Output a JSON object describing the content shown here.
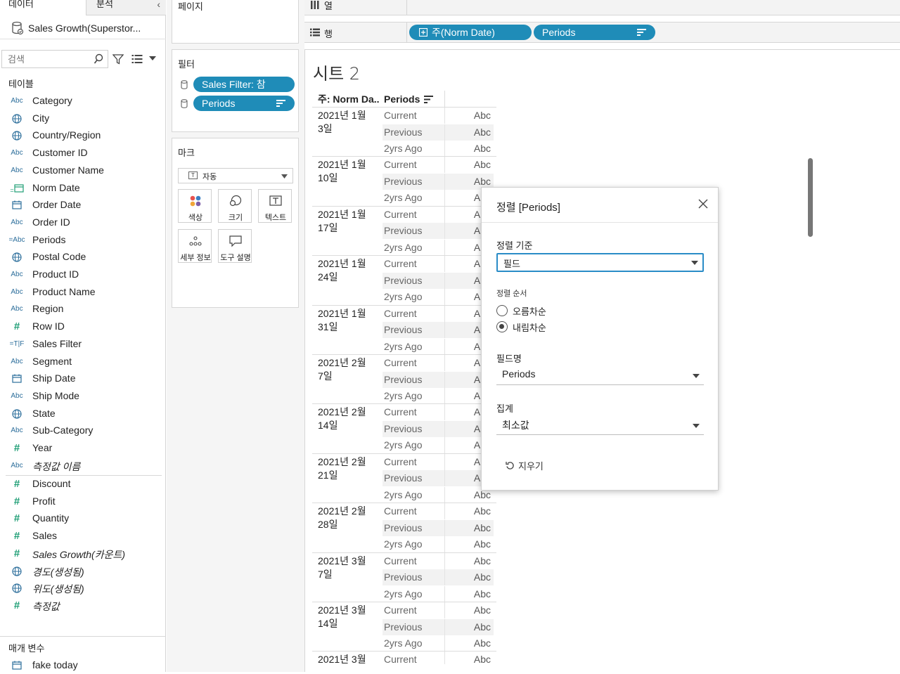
{
  "left_pane": {
    "tabs": {
      "data": "데이터",
      "analysis": "분석"
    },
    "datasource": "Sales Growth(Superstor...",
    "search_placeholder": "검색",
    "tables_title": "테이블",
    "fields": [
      {
        "icon": "Abc",
        "label": "Category"
      },
      {
        "icon": "globe",
        "label": "City"
      },
      {
        "icon": "globe",
        "label": "Country/Region"
      },
      {
        "icon": "Abc",
        "label": "Customer ID"
      },
      {
        "icon": "Abc",
        "label": "Customer Name"
      },
      {
        "icon": "calc-calendar",
        "label": "Norm Date"
      },
      {
        "icon": "calendar",
        "label": "Order Date"
      },
      {
        "icon": "Abc",
        "label": "Order ID"
      },
      {
        "icon": "=Abc",
        "label": "Periods"
      },
      {
        "icon": "globe",
        "label": "Postal Code"
      },
      {
        "icon": "Abc",
        "label": "Product ID"
      },
      {
        "icon": "Abc",
        "label": "Product Name"
      },
      {
        "icon": "Abc",
        "label": "Region"
      },
      {
        "icon": "#",
        "label": "Row ID"
      },
      {
        "icon": "=T|F",
        "label": "Sales Filter"
      },
      {
        "icon": "Abc",
        "label": "Segment"
      },
      {
        "icon": "calendar",
        "label": "Ship Date"
      },
      {
        "icon": "Abc",
        "label": "Ship Mode"
      },
      {
        "icon": "globe",
        "label": "State"
      },
      {
        "icon": "Abc",
        "label": "Sub-Category"
      },
      {
        "icon": "#",
        "label": "Year"
      },
      {
        "icon": "Abc",
        "label": "측정값 이름",
        "italic": true
      }
    ],
    "measures": [
      {
        "icon": "#",
        "label": "Discount"
      },
      {
        "icon": "#",
        "label": "Profit"
      },
      {
        "icon": "#",
        "label": "Quantity"
      },
      {
        "icon": "#",
        "label": "Sales"
      },
      {
        "icon": "#",
        "label": "Sales Growth(카운트)",
        "italic": true
      },
      {
        "icon": "globe",
        "label": "경도(생성됨)",
        "italic": true
      },
      {
        "icon": "globe",
        "label": "위도(생성됨)",
        "italic": true
      },
      {
        "icon": "#",
        "label": "측정값",
        "italic": true
      }
    ],
    "params_title": "매개 변수",
    "params": [
      {
        "icon": "calendar",
        "label": "fake today"
      }
    ]
  },
  "pages": {
    "title": "페이지"
  },
  "filters": {
    "title": "필터",
    "pills": [
      "Sales Filter: 참",
      "Periods"
    ]
  },
  "marks": {
    "title": "마크",
    "mark_type": "자동",
    "mark_type_icon": "T",
    "buttons": [
      "색상",
      "크기",
      "텍스트",
      "세부 정보",
      "도구 설명"
    ]
  },
  "shelves": {
    "columns_label": "열",
    "rows_label": "행",
    "row_pills": [
      "주(Norm Date)",
      "Periods"
    ]
  },
  "view": {
    "sheet_title": "시트 2",
    "headers": [
      "주: Norm Da..",
      "Periods"
    ],
    "abc": "Abc",
    "dates": [
      [
        "2021년 1월",
        "3일"
      ],
      [
        "2021년 1월",
        "10일"
      ],
      [
        "2021년 1월",
        "17일"
      ],
      [
        "2021년 1월",
        "24일"
      ],
      [
        "2021년 1월",
        "31일"
      ],
      [
        "2021년 2월",
        "7일"
      ],
      [
        "2021년 2월",
        "14일"
      ],
      [
        "2021년 2월",
        "21일"
      ],
      [
        "2021년 2월",
        "28일"
      ],
      [
        "2021년 3월",
        "7일"
      ],
      [
        "2021년 3월",
        "14일"
      ],
      [
        "2021년 3월",
        ""
      ]
    ],
    "periods": [
      "Current",
      "Previous",
      "2yrs Ago"
    ]
  },
  "dialog": {
    "title": "정렬 [Periods]",
    "sort_by_label": "정렬 기준",
    "sort_by_value": "필드",
    "sort_order_label": "정렬 순서",
    "ascending": "오름차순",
    "descending": "내림차순",
    "selected_order": "descending",
    "field_name_label": "필드명",
    "field_name_value": "Periods",
    "aggregation_label": "집계",
    "aggregation_value": "최소값",
    "clear_label": "지우기"
  },
  "colors": {
    "pill": "#1f8cb8",
    "accent_focus": "#2a8cc7",
    "measure_icon": "#1e9e75",
    "dimension_icon": "#2c6e9b"
  }
}
